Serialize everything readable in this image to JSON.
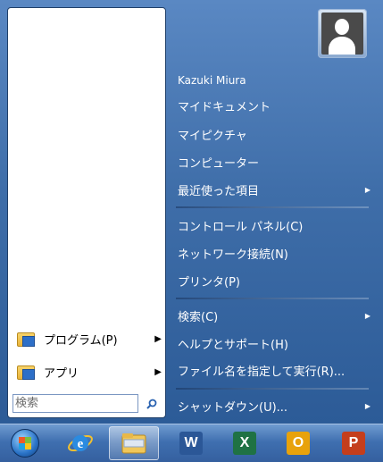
{
  "user": {
    "name": "Kazuki Miura"
  },
  "right_menu": {
    "documents": "マイドキュメント",
    "pictures": "マイピクチャ",
    "computer": "コンピューター",
    "recent": "最近使った項目",
    "control_panel": "コントロール パネル(C)",
    "network": "ネットワーク接続(N)",
    "printers": "プリンタ(P)",
    "search": "検索(C)",
    "help": "ヘルプとサポート(H)",
    "run": "ファイル名を指定して実行(R)...",
    "shutdown": "シャットダウン(U)..."
  },
  "left_menu": {
    "programs": "プログラム(P)",
    "apps": "アプリ"
  },
  "search": {
    "placeholder": "検索"
  },
  "taskbar": {
    "items": [
      {
        "name": "start-button",
        "icon": "windows-orb-icon"
      },
      {
        "name": "internet-explorer",
        "icon": "internet-explorer-icon"
      },
      {
        "name": "file-explorer",
        "icon": "folder-icon",
        "active": true
      },
      {
        "name": "word",
        "icon": "word-icon",
        "label": "W"
      },
      {
        "name": "excel",
        "icon": "excel-icon",
        "label": "X"
      },
      {
        "name": "outlook",
        "icon": "outlook-icon",
        "label": "O"
      },
      {
        "name": "powerpoint",
        "icon": "powerpoint-icon",
        "label": "P"
      }
    ]
  },
  "colors": {
    "accent": "#3f6ea9",
    "word": "#2b5797",
    "excel": "#1f7244",
    "outlook": "#e8a20c",
    "powerpoint": "#c43e1c"
  }
}
